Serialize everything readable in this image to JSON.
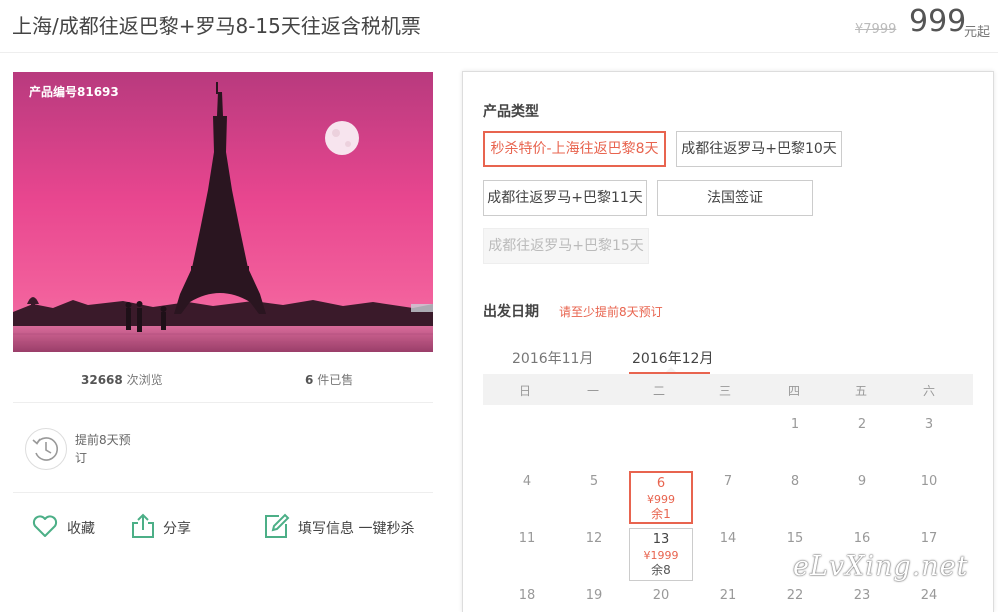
{
  "product": {
    "title": "上海/成都往返巴黎+罗马8-15天往返含税机票",
    "original_price": "¥7999",
    "price": "999",
    "price_unit": "元起",
    "product_no": "产品编号81693"
  },
  "stats": {
    "views_count": "32668",
    "views_label": "次浏览",
    "sold_count": "6",
    "sold_label": "件已售"
  },
  "advance": {
    "text": "提前8天预订",
    "icon": "clock-icon"
  },
  "actions": {
    "favorite": {
      "label": "收藏",
      "icon": "heart-icon"
    },
    "share": {
      "label": "分享",
      "icon": "share-icon"
    },
    "fill_info": {
      "label": "填写信息 一键秒杀",
      "icon": "edit-icon"
    }
  },
  "product_type": {
    "label": "产品类型",
    "options": [
      {
        "label": "秒杀特价-上海往返巴黎8天",
        "state": "selected"
      },
      {
        "label": "成都往返罗马+巴黎10天",
        "state": "normal"
      },
      {
        "label": "成都往返罗马+巴黎11天",
        "state": "normal"
      },
      {
        "label": "法国签证",
        "state": "normal"
      },
      {
        "label": "成都往返罗马+巴黎15天",
        "state": "disabled"
      }
    ]
  },
  "departure": {
    "label": "出发日期",
    "hint": "请至少提前8天预订"
  },
  "calendar": {
    "months": [
      "2016年11月",
      "2016年12月"
    ],
    "active_month": "2016年12月",
    "weekdays": [
      "日",
      "一",
      "二",
      "三",
      "四",
      "五",
      "六"
    ],
    "week1": [
      "1",
      "2",
      "3"
    ],
    "week2": [
      "4",
      "5",
      "7",
      "8",
      "9",
      "10"
    ],
    "week3": [
      "11",
      "12",
      "14",
      "15",
      "16",
      "17"
    ],
    "week4": [
      "18",
      "19",
      "20",
      "21",
      "22",
      "23",
      "24"
    ],
    "selected_day": {
      "day": "6",
      "price": "¥999",
      "remaining": "余1"
    },
    "available_day": {
      "day": "13",
      "price": "¥1999",
      "remaining": "余8"
    }
  },
  "watermark": "eLvXing.net",
  "colors": {
    "accent": "#e8644f",
    "icon_green": "#4caf87"
  }
}
